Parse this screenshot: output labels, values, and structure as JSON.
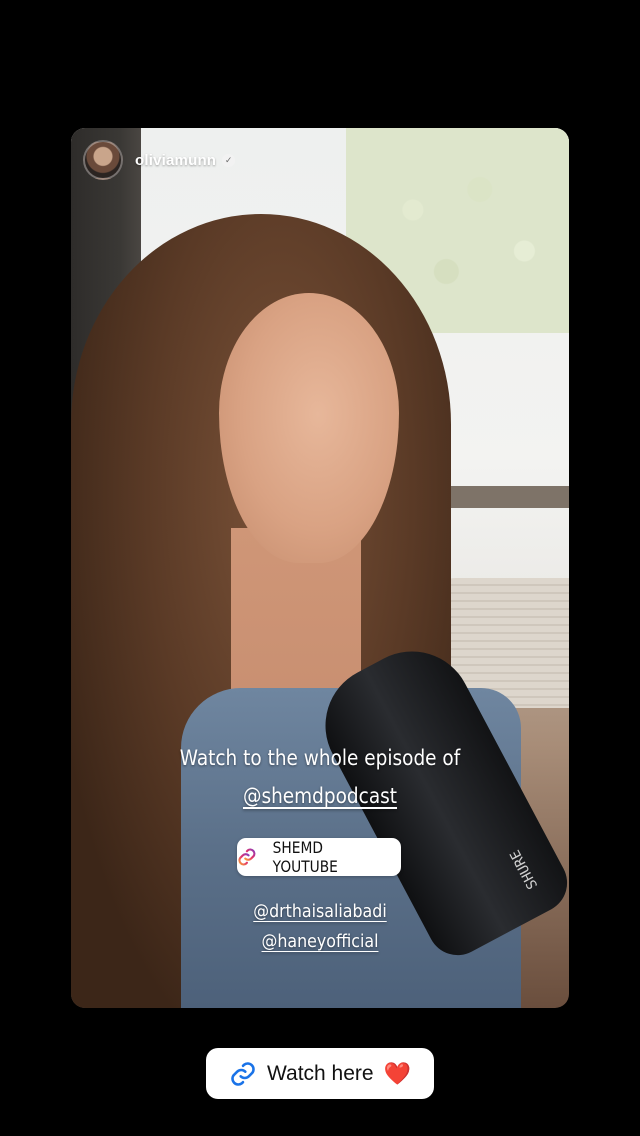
{
  "story": {
    "username": "oliviamunn",
    "verified": true,
    "caption": "Watch to the whole episode of",
    "mention_main": "@shemdpodcast",
    "link_sticker": {
      "label": "SHEMD YOUTUBE",
      "icon": "link-icon"
    },
    "mentions": [
      "@drthaisaliabadi",
      "@haneyofficial"
    ]
  },
  "cta": {
    "label": "Watch here",
    "icon": "link-icon",
    "emoji": "❤️"
  },
  "colors": {
    "background": "#000000",
    "button_bg": "#ffffff",
    "link_icon_blue": "#1a73e8",
    "heart_red": "#d21f2a"
  }
}
